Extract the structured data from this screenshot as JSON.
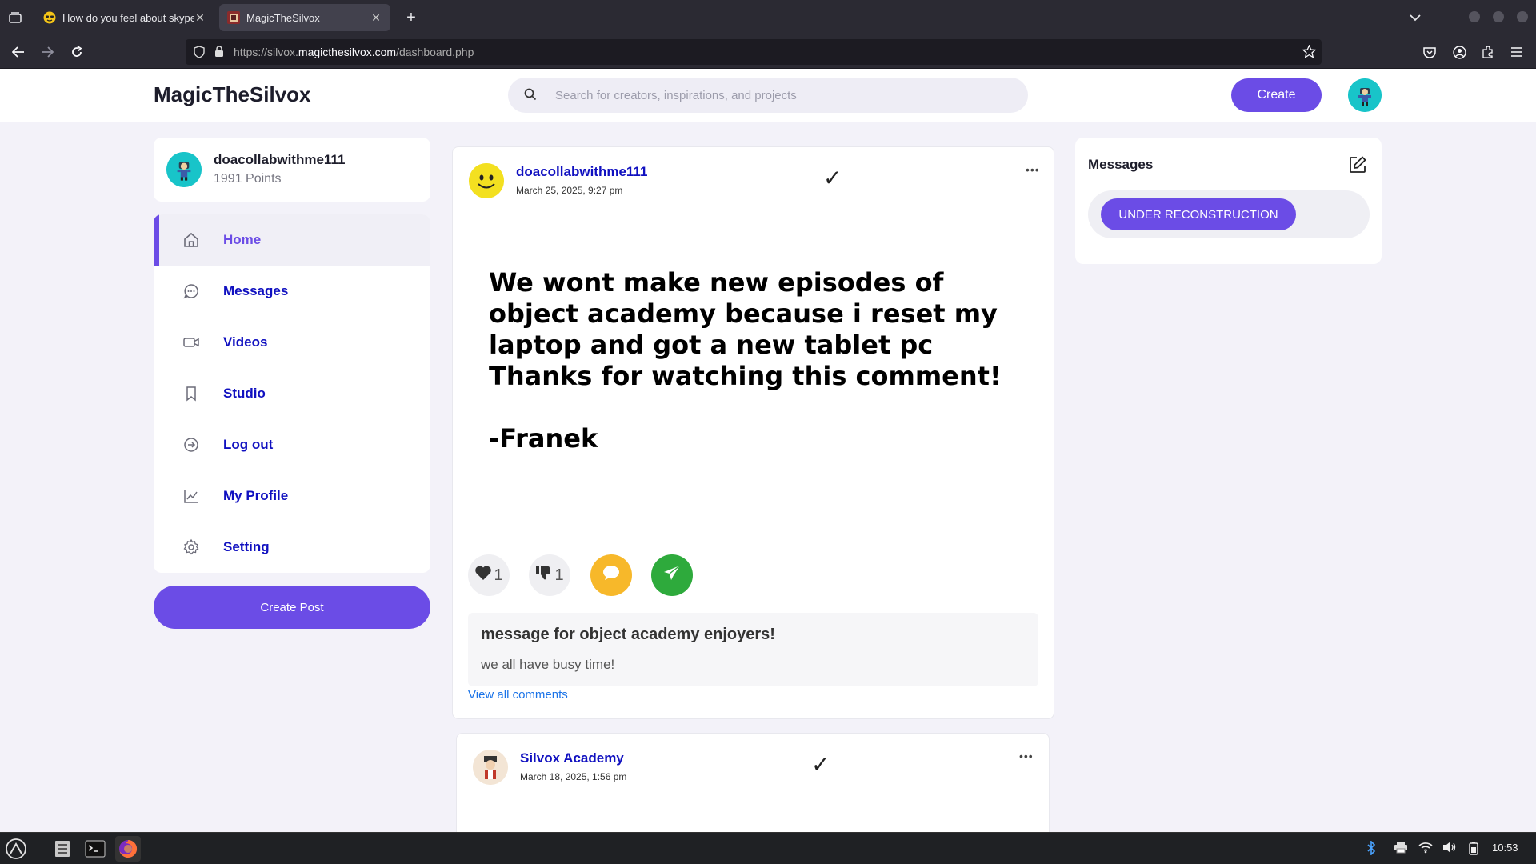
{
  "browser": {
    "tabs": [
      {
        "title": "How do you feel about skype",
        "active": false
      },
      {
        "title": "MagicTheSilvox",
        "active": true
      }
    ],
    "url_prefix": "https://silvox.",
    "url_domain": "magicthesilvox.com",
    "url_path": "/dashboard.php"
  },
  "header": {
    "logo": "MagicTheSilvox",
    "search_placeholder": "Search for creators, inspirations, and projects",
    "create_label": "Create"
  },
  "profile": {
    "username": "doacollabwithme111",
    "points": "1991 Points"
  },
  "menu": {
    "items": [
      {
        "label": "Home",
        "icon": "home-icon",
        "active": true
      },
      {
        "label": "Messages",
        "icon": "chat-icon"
      },
      {
        "label": "Videos",
        "icon": "video-icon"
      },
      {
        "label": "Studio",
        "icon": "bookmark-icon"
      },
      {
        "label": "Log out",
        "icon": "logout-icon"
      },
      {
        "label": "My Profile",
        "icon": "chart-icon"
      },
      {
        "label": "Setting",
        "icon": "gear-icon"
      }
    ],
    "create_post_label": "Create Post"
  },
  "post": {
    "author": "doacollabwithme111",
    "date": "March 25, 2025, 9:27 pm",
    "check": "✓",
    "more": "•••",
    "body": "We wont make new episodes of object academy because i reset my laptop and got a new tablet pc\nThanks for watching this comment!\n\n-Franek",
    "likes": "1",
    "dislikes": "1",
    "comment_title": "message for object academy enjoyers!",
    "comment_text": "we all have busy time!",
    "view_all": "View all comments"
  },
  "post2": {
    "author": "Silvox Academy",
    "date": "March 18, 2025, 1:56 pm",
    "check": "✓",
    "more": "•••"
  },
  "messages_panel": {
    "title": "Messages",
    "button_label": "UNDER RECONSTRUCTION"
  },
  "taskbar": {
    "clock": "10:53"
  },
  "colors": {
    "accent": "#6b4ce6",
    "link": "#1010c0",
    "like_comment": "#f7b82a",
    "share": "#2eaa3c",
    "avatar_bg": "#18c4c9"
  }
}
